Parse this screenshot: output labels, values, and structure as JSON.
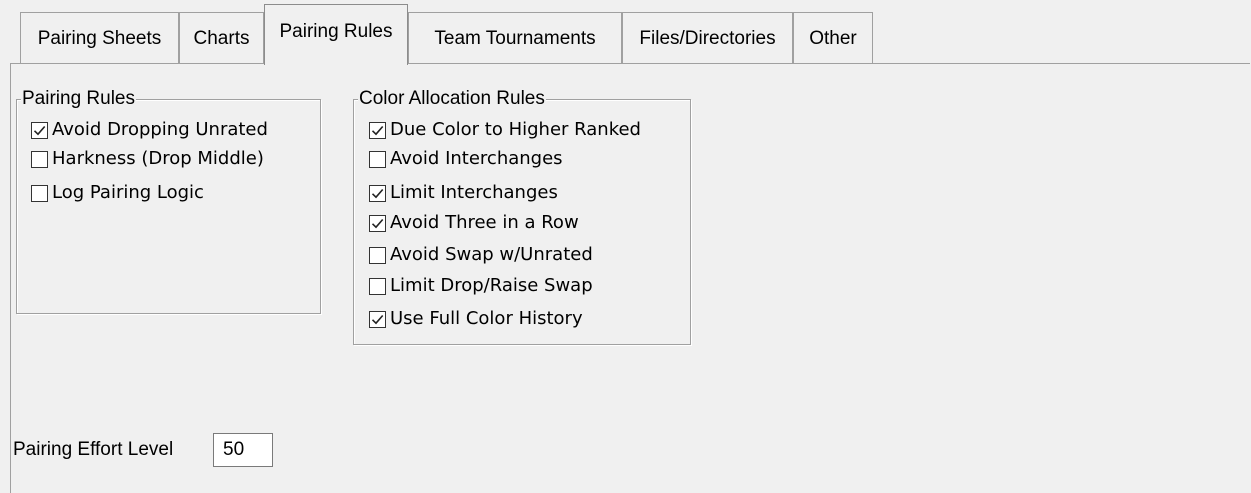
{
  "tabs": [
    {
      "label": "Pairing Sheets",
      "active": false
    },
    {
      "label": "Charts",
      "active": false
    },
    {
      "label": "Pairing Rules",
      "active": true
    },
    {
      "label": "Team Tournaments",
      "active": false
    },
    {
      "label": "Files/Directories",
      "active": false
    },
    {
      "label": "Other",
      "active": false
    }
  ],
  "pairing_rules": {
    "title": "Pairing Rules",
    "items": [
      {
        "label": "Avoid Dropping Unrated",
        "checked": true
      },
      {
        "label": "Harkness (Drop Middle)",
        "checked": false
      },
      {
        "label": "Log Pairing Logic",
        "checked": false
      }
    ]
  },
  "color_rules": {
    "title": "Color Allocation Rules",
    "items": [
      {
        "label": "Due Color to Higher Ranked",
        "checked": true
      },
      {
        "label": "Avoid Interchanges",
        "checked": false
      },
      {
        "label": "Limit Interchanges",
        "checked": true
      },
      {
        "label": "Avoid Three in a Row",
        "checked": true
      },
      {
        "label": "Avoid Swap w/Unrated",
        "checked": false
      },
      {
        "label": "Limit Drop/Raise Swap",
        "checked": false
      },
      {
        "label": "Use Full Color History",
        "checked": true
      }
    ]
  },
  "effort": {
    "label": "Pairing Effort Level",
    "value": "50"
  }
}
